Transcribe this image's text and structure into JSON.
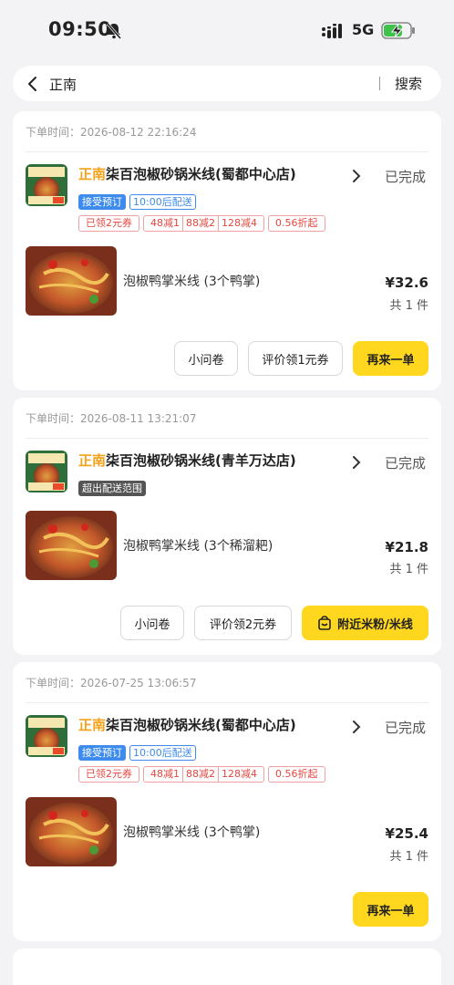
{
  "status_bar": {
    "time": "09:50",
    "network": "5G"
  },
  "search": {
    "query": "正南",
    "button_label": "搜索"
  },
  "colors": {
    "accent_yellow": "#ffd71e",
    "brand_orange": "#f4a21a",
    "promo_red": "#e5463f",
    "tag_blue": "#3d8bec"
  },
  "orders": [
    {
      "order_time": "下单时间：2026-08-12 22:16:24",
      "store_brand": "正南",
      "store_rest": "柒百泡椒砂锅米线(蜀都中心店)",
      "status": "已完成",
      "tag_main": "接受预订",
      "tag_secondary": "10:00后配送",
      "promo_coupon": "已领2元券",
      "promo_discounts": [
        "48减1",
        "88减2",
        "128减4"
      ],
      "promo_rate": "0.56折起",
      "dish_name": "泡椒鸭掌米线 (3个鸭掌)",
      "price": "¥32.6",
      "count": "共 1 件",
      "buttons": [
        "小问卷",
        "评价领1元券",
        "再来一单"
      ]
    },
    {
      "order_time": "下单时间：2026-08-11 13:21:07",
      "store_brand": "正南",
      "store_rest": "柒百泡椒砂锅米线(青羊万达店)",
      "status": "已完成",
      "tag_main": "超出配送范围",
      "dish_name": "泡椒鸭掌米线 (3个稀溜耙)",
      "price": "¥21.8",
      "count": "共 1 件",
      "buttons": [
        "小问卷",
        "评价领2元券",
        "附近米粉/米线"
      ]
    },
    {
      "order_time": "下单时间：2026-07-25 13:06:57",
      "store_brand": "正南",
      "store_rest": "柒百泡椒砂锅米线(蜀都中心店)",
      "status": "已完成",
      "tag_main": "接受预订",
      "tag_secondary": "10:00后配送",
      "promo_coupon": "已领2元券",
      "promo_discounts": [
        "48减1",
        "88减2",
        "128减4"
      ],
      "promo_rate": "0.56折起",
      "dish_name": "泡椒鸭掌米线 (3个鸭掌)",
      "price": "¥25.4",
      "count": "共 1 件",
      "buttons": [
        "再来一单"
      ]
    }
  ]
}
